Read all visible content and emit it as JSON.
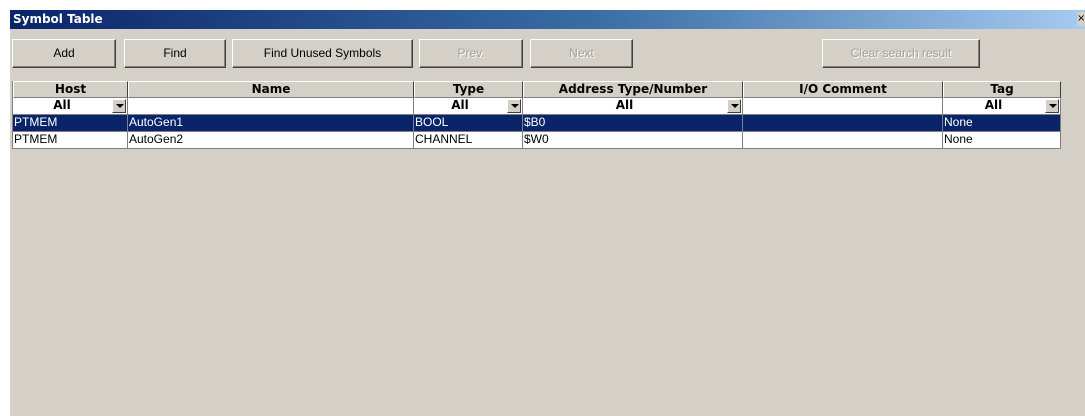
{
  "window": {
    "title": "Symbol Table",
    "close": "×"
  },
  "toolbar": {
    "add": "Add",
    "find": "Find",
    "find_unused": "Find Unused Symbols",
    "prev": "Prev.",
    "next": "Next",
    "clear": "Clear search result"
  },
  "columns": {
    "host": "Host",
    "name": "Name",
    "type": "Type",
    "address": "Address Type/Number",
    "io_comment": "I/O Comment",
    "tag": "Tag"
  },
  "filters": {
    "host": "All",
    "type": "All",
    "address": "All",
    "tag": "All"
  },
  "rows": [
    {
      "host": "PTMEM",
      "name": "AutoGen1",
      "type": "BOOL",
      "address": "$B0",
      "io_comment": "",
      "tag": "None",
      "selected": true
    },
    {
      "host": "PTMEM",
      "name": "AutoGen2",
      "type": "CHANNEL",
      "address": "$W0",
      "io_comment": "",
      "tag": "None",
      "selected": false
    }
  ]
}
